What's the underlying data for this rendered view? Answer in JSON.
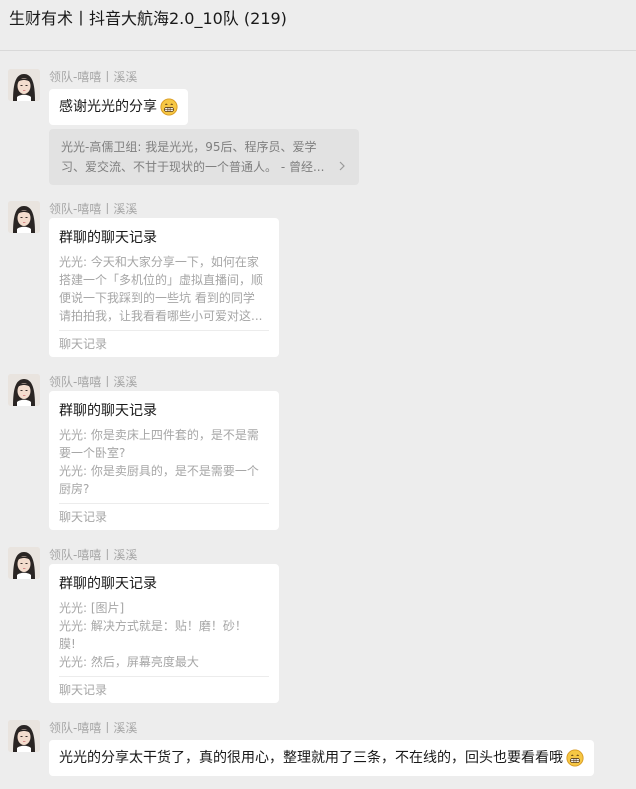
{
  "header": {
    "title": "生财有术丨抖音大航海2.0_10队 (219)"
  },
  "sender_name": "领队-嘻嘻丨溪溪",
  "messages": {
    "m1": {
      "text": "感谢光光的分享",
      "emoji": "grin-emoji",
      "quote": {
        "line1": "光光-高儒卫组: 我是光光，95后、程序员、爱学",
        "line2": "习、爱交流、不甘于现状的一个普通人。 - 曾经..."
      }
    },
    "m2": {
      "card_title": "群聊的聊天记录",
      "lines": [
        "光光: 今天和大家分享一下，如何在家",
        "搭建一个「多机位的」虚拟直播间，顺",
        "便说一下我踩到的一些坑 看到的同学",
        "请拍拍我，让我看看哪些小可爱对这..."
      ],
      "footer": "聊天记录"
    },
    "m3": {
      "card_title": "群聊的聊天记录",
      "lines": [
        "光光: 你是卖床上四件套的，是不是需",
        "要一个卧室?",
        "光光: 你是卖厨具的，是不是需要一个",
        "厨房?"
      ],
      "footer": "聊天记录"
    },
    "m4": {
      "card_title": "群聊的聊天记录",
      "lines": [
        "光光: [图片]",
        "光光: 解决方式就是：贴！磨！砂！",
        "膜!",
        "光光: 然后，屏幕亮度最大"
      ],
      "footer": "聊天记录"
    },
    "m5": {
      "text": "光光的分享太干货了，真的很用心，整理就用了三条，不在线的，回头也要看看哦",
      "emoji": "grin-emoji"
    }
  },
  "colors": {
    "background": "#ededed",
    "bubble": "#ffffff",
    "quote_bg": "#e2e2e2",
    "meta_text": "#a6a6a6"
  }
}
